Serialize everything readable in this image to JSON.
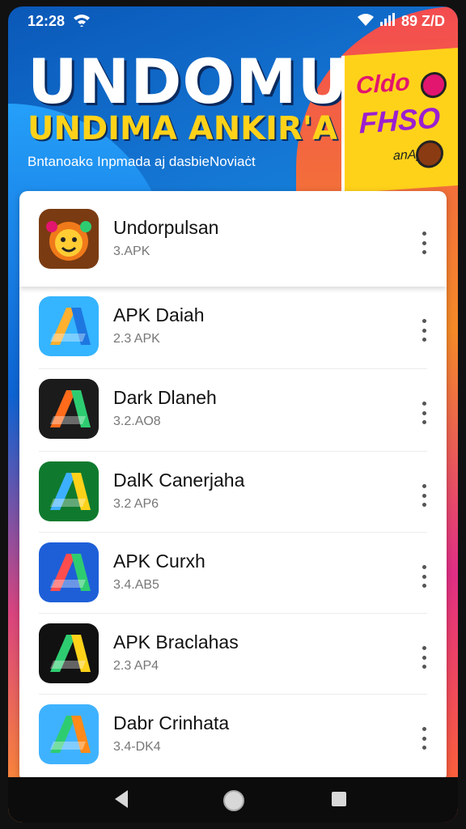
{
  "status_bar": {
    "time": "12:28",
    "right_text": "89 Z/D"
  },
  "banner": {
    "title": "UNDOMUN",
    "title_end": "N",
    "subtitle": "UNDIMA ANKIR'A",
    "tagline": "Bntanoakɢ Inpmada aj dasbieNoviaċt",
    "sticker": {
      "line1": "Cldo",
      "line2": "FHSO",
      "line3": "anApt"
    }
  },
  "apps": [
    {
      "name": "Undorpulsan",
      "version": "3.APK",
      "icon": "cartoon-face-icon",
      "colors": [
        "#f07a1a",
        "#7a3b12",
        "#ffcc33"
      ]
    },
    {
      "name": "APK Daiah",
      "version": "2.3 APK",
      "icon": "apk-arrow-icon",
      "colors": [
        "#35b4ff",
        "#ffb02e",
        "#1e77e0"
      ]
    },
    {
      "name": "Dark Dlaneh",
      "version": "3.2.AO8",
      "icon": "apk-arrow-icon",
      "colors": [
        "#1b1b1b",
        "#ff6b1a",
        "#2ecc71"
      ]
    },
    {
      "name": "DalK Canerjaha",
      "version": "3.2 AP6",
      "icon": "apk-arrow-icon",
      "colors": [
        "#0f7a2e",
        "#3cb0ff",
        "#ffd21a"
      ]
    },
    {
      "name": "APK Curxh",
      "version": "3.4.AB5",
      "icon": "apk-arrow-icon",
      "colors": [
        "#1e5fd8",
        "#ff4d4d",
        "#2ecc71"
      ]
    },
    {
      "name": "APK Braclahas",
      "version": "2.3 AP4",
      "icon": "apk-arrow-icon",
      "colors": [
        "#111111",
        "#2ecc71",
        "#ffd21a"
      ]
    },
    {
      "name": "Dabr Crinhata",
      "version": "3.4-DK4",
      "icon": "apk-arrow-icon",
      "colors": [
        "#3fb2ff",
        "#2ecc71",
        "#ff8a1a"
      ]
    }
  ],
  "nav": {
    "back": "back-icon",
    "home": "home-icon",
    "recents": "recents-icon"
  }
}
